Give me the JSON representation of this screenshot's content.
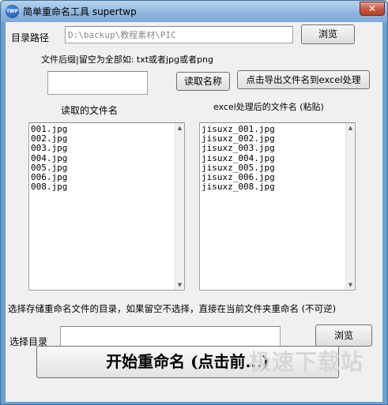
{
  "window": {
    "title": "简单重命名工具 supertwp",
    "app_icon_text": "TWP",
    "close_glyph": "✕"
  },
  "directory": {
    "label": "目录路径",
    "value": "D:\\backup\\教程素材\\PIC",
    "browse_label": "浏览"
  },
  "suffix": {
    "hint": "文件后缀|留空为全部如: txt或者jpg或者png",
    "value": "",
    "read_button": "读取名称",
    "export_button": "点击导出文件名到excel处理"
  },
  "left_list": {
    "heading": "读取的文件名",
    "items": [
      "001.jpg",
      "002.jpg",
      "003.jpg",
      "004.jpg",
      "005.jpg",
      "006.jpg",
      "008.jpg"
    ]
  },
  "right_list": {
    "heading": "excel处理后的文件名 (粘贴)",
    "items": [
      "jisuxz_001.jpg",
      "jisuxz_002.jpg",
      "jisuxz_003.jpg",
      "jisuxz_004.jpg",
      "jisuxz_005.jpg",
      "jisuxz_006.jpg",
      "jisuxz_008.jpg"
    ]
  },
  "output": {
    "note": "选择存储重命名文件的目录，如果留空不选择，直接在当前文件夹重命名 (不可逆)",
    "label": "选择目录",
    "value": "",
    "browse_label": "浏览"
  },
  "start_button": "开始重命名 (点击前...)",
  "watermark": "极速下载站"
}
